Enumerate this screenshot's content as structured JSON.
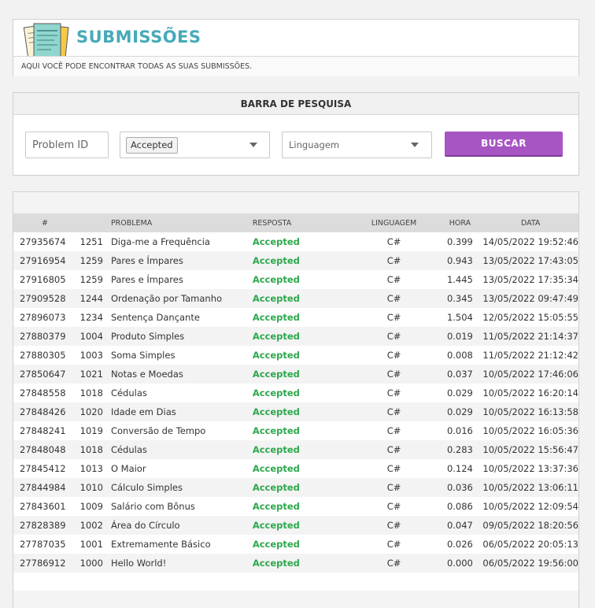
{
  "header": {
    "title": "SUBMISSÕES",
    "subtitle": "AQUI VOCÊ PODE ENCONTRAR TODAS AS SUAS SUBMISSÕES."
  },
  "search": {
    "title": "BARRA DE PESQUISA",
    "problem_id_placeholder": "Problem ID",
    "resposta_selected": "Accepted",
    "linguagem_placeholder": "Linguagem",
    "buscar_label": "BUSCAR"
  },
  "table": {
    "headers": {
      "id": "#",
      "num": "",
      "problema": "PROBLEMA",
      "resposta": "RESPOSTA",
      "linguagem": "LINGUAGEM",
      "hora": "HORA",
      "data": "DATA"
    },
    "rows": [
      {
        "id": "27935674",
        "num": "1251",
        "problema": "Diga-me a Frequência",
        "resposta": "Accepted",
        "linguagem": "C#",
        "hora": "0.399",
        "data": "14/05/2022 19:52:46"
      },
      {
        "id": "27916954",
        "num": "1259",
        "problema": "Pares e Ímpares",
        "resposta": "Accepted",
        "linguagem": "C#",
        "hora": "0.943",
        "data": "13/05/2022 17:43:05"
      },
      {
        "id": "27916805",
        "num": "1259",
        "problema": "Pares e Ímpares",
        "resposta": "Accepted",
        "linguagem": "C#",
        "hora": "1.445",
        "data": "13/05/2022 17:35:34"
      },
      {
        "id": "27909528",
        "num": "1244",
        "problema": "Ordenação por Tamanho",
        "resposta": "Accepted",
        "linguagem": "C#",
        "hora": "0.345",
        "data": "13/05/2022 09:47:49"
      },
      {
        "id": "27896073",
        "num": "1234",
        "problema": "Sentença Dançante",
        "resposta": "Accepted",
        "linguagem": "C#",
        "hora": "1.504",
        "data": "12/05/2022 15:05:55"
      },
      {
        "id": "27880379",
        "num": "1004",
        "problema": "Produto Simples",
        "resposta": "Accepted",
        "linguagem": "C#",
        "hora": "0.019",
        "data": "11/05/2022 21:14:37"
      },
      {
        "id": "27880305",
        "num": "1003",
        "problema": "Soma Simples",
        "resposta": "Accepted",
        "linguagem": "C#",
        "hora": "0.008",
        "data": "11/05/2022 21:12:42"
      },
      {
        "id": "27850647",
        "num": "1021",
        "problema": "Notas e Moedas",
        "resposta": "Accepted",
        "linguagem": "C#",
        "hora": "0.037",
        "data": "10/05/2022 17:46:06"
      },
      {
        "id": "27848558",
        "num": "1018",
        "problema": "Cédulas",
        "resposta": "Accepted",
        "linguagem": "C#",
        "hora": "0.029",
        "data": "10/05/2022 16:20:14"
      },
      {
        "id": "27848426",
        "num": "1020",
        "problema": "Idade em Dias",
        "resposta": "Accepted",
        "linguagem": "C#",
        "hora": "0.029",
        "data": "10/05/2022 16:13:58"
      },
      {
        "id": "27848241",
        "num": "1019",
        "problema": "Conversão de Tempo",
        "resposta": "Accepted",
        "linguagem": "C#",
        "hora": "0.016",
        "data": "10/05/2022 16:05:36"
      },
      {
        "id": "27848048",
        "num": "1018",
        "problema": "Cédulas",
        "resposta": "Accepted",
        "linguagem": "C#",
        "hora": "0.283",
        "data": "10/05/2022 15:56:47"
      },
      {
        "id": "27845412",
        "num": "1013",
        "problema": "O Maior",
        "resposta": "Accepted",
        "linguagem": "C#",
        "hora": "0.124",
        "data": "10/05/2022 13:37:36"
      },
      {
        "id": "27844984",
        "num": "1010",
        "problema": "Cálculo Simples",
        "resposta": "Accepted",
        "linguagem": "C#",
        "hora": "0.036",
        "data": "10/05/2022 13:06:11"
      },
      {
        "id": "27843601",
        "num": "1009",
        "problema": "Salário com Bônus",
        "resposta": "Accepted",
        "linguagem": "C#",
        "hora": "0.086",
        "data": "10/05/2022 12:09:54"
      },
      {
        "id": "27828389",
        "num": "1002",
        "problema": "Área do Círculo",
        "resposta": "Accepted",
        "linguagem": "C#",
        "hora": "0.047",
        "data": "09/05/2022 18:20:56"
      },
      {
        "id": "27787035",
        "num": "1001",
        "problema": "Extremamente Básico",
        "resposta": "Accepted",
        "linguagem": "C#",
        "hora": "0.026",
        "data": "06/05/2022 20:05:13"
      },
      {
        "id": "27786912",
        "num": "1000",
        "problema": "Hello World!",
        "resposta": "Accepted",
        "linguagem": "C#",
        "hora": "0.000",
        "data": "06/05/2022 19:56:00"
      }
    ]
  },
  "colors": {
    "title": "#46aab8",
    "accepted": "#2da84d",
    "button": "#a855c4"
  }
}
